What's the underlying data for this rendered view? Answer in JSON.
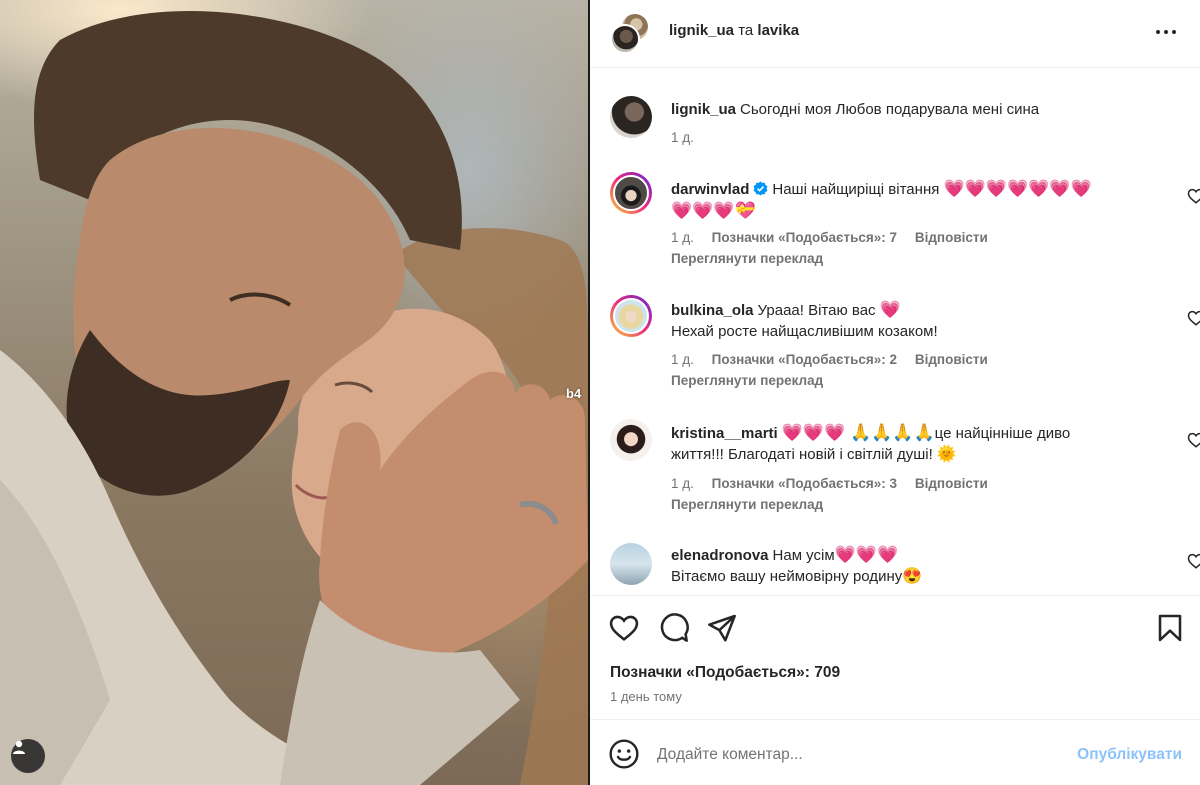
{
  "photo": {
    "watermark": "b4",
    "alt": "Портрет пари"
  },
  "header": {
    "user1": "lignik_ua",
    "conjunction": "та",
    "user2": "lavika"
  },
  "caption": {
    "user": "lignik_ua",
    "text": "Сьогодні моя Любов подарувала мені сина",
    "time": "1 д."
  },
  "comments": [
    {
      "user": "darwinvlad",
      "verified": true,
      "text": "Наші найщиріщі вітання",
      "emojis": "💗💗💗💗💗💗💗",
      "emojis2": "💗💗💗💝",
      "time": "1 д.",
      "likes": "Позначки «Подобається»: 7",
      "reply": "Відповісти",
      "translate": "Переглянути переклад"
    },
    {
      "user": "bulkina_ola",
      "text": "Урааа! Вітаю вас",
      "emojis": "💗",
      "text2": "Нехай росте найщасливішим козаком!",
      "time": "1 д.",
      "likes": "Позначки «Подобається»: 2",
      "reply": "Відповісти",
      "translate": "Переглянути переклад"
    },
    {
      "user": "kristina__marti",
      "emojis": "💗💗💗 🙏🙏🙏🙏",
      "text": "це найцінніше диво",
      "text2": "життя!!! Благодаті новій і світлій душі!",
      "emoji_end": "🌞",
      "time": "1 д.",
      "likes": "Позначки «Подобається»: 3",
      "reply": "Відповісти",
      "translate": "Переглянути переклад"
    },
    {
      "user": "elenadronova",
      "text": "Нам усім",
      "emojis": "💗💗💗",
      "text2": "Вітаємо вашу неймовірну родину",
      "emoji_end": "😍"
    }
  ],
  "stats": {
    "likes": "Позначки «Подобається»: 709",
    "time": "1 день тому"
  },
  "composer": {
    "placeholder": "Додайте коментар...",
    "post_label": "Опублікувати"
  },
  "icons": {
    "more": "more-options-icon",
    "like": "heart-icon",
    "comment": "comment-icon",
    "share": "share-icon",
    "save": "bookmark-icon",
    "emoji": "emoji-icon",
    "user_tag": "user-icon"
  },
  "colors": {
    "accent_blue": "#0095f6",
    "post_disabled": "#8dc3f8",
    "heart_emoji": "#f0255f",
    "muted_text": "#737373"
  }
}
